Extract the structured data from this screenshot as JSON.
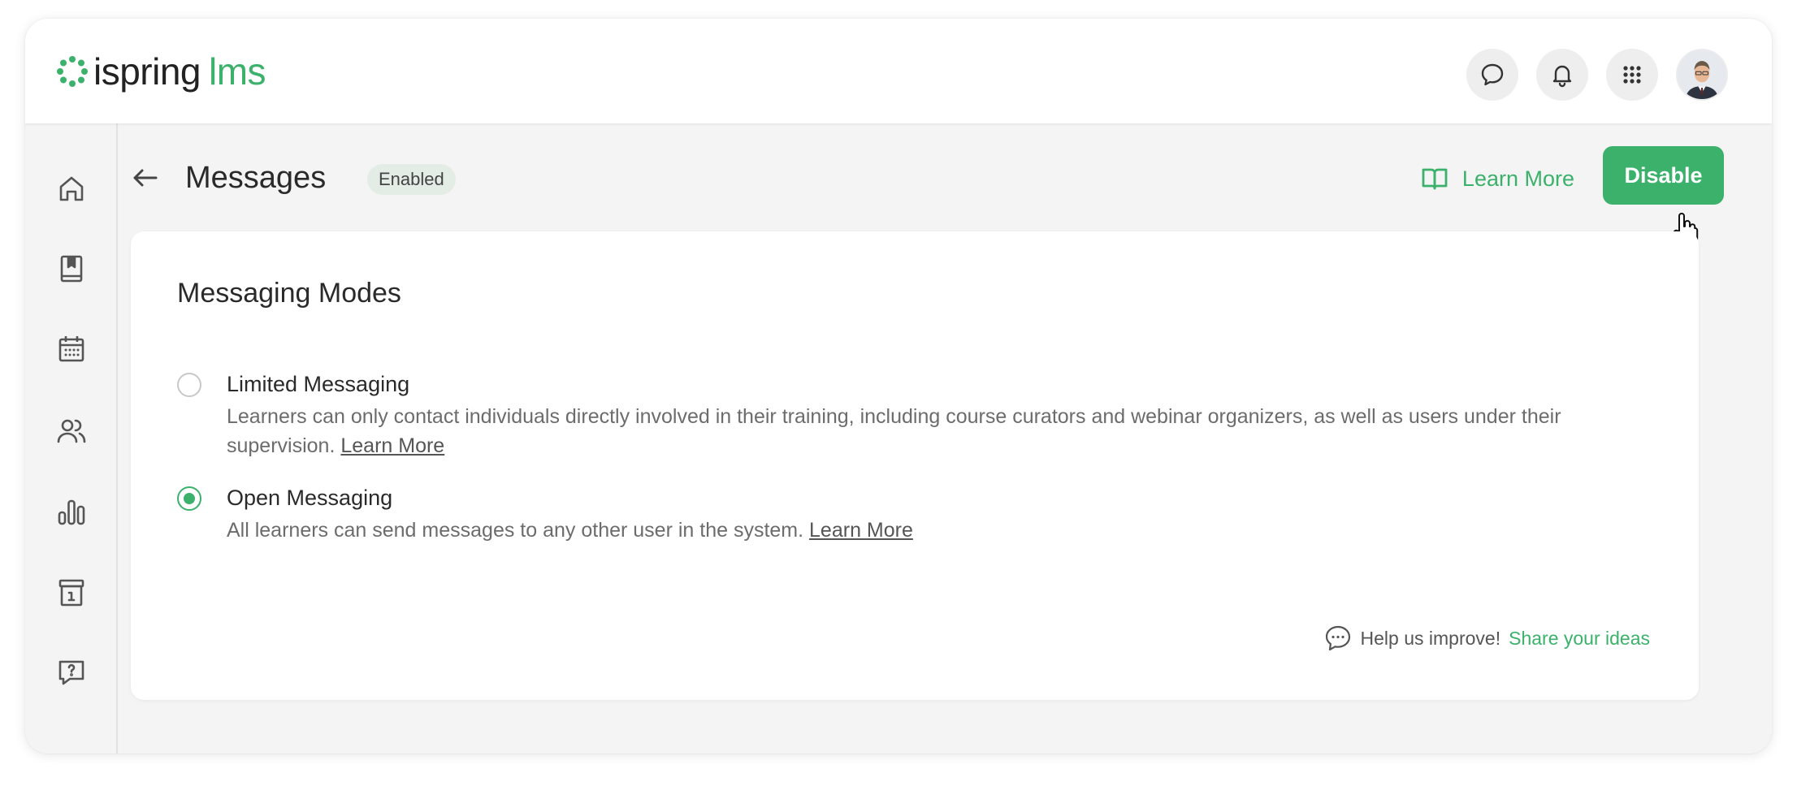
{
  "brand": {
    "name": "ispring",
    "suffix": "lms",
    "accent_color": "#3bb16b"
  },
  "topbar": {
    "icons": [
      "chat-icon",
      "bell-icon",
      "apps-grid-icon",
      "user-avatar"
    ]
  },
  "sidebar": {
    "items": [
      {
        "icon": "home-icon"
      },
      {
        "icon": "book-icon"
      },
      {
        "icon": "calendar-icon"
      },
      {
        "icon": "users-icon"
      },
      {
        "icon": "chart-icon"
      },
      {
        "icon": "info-box-icon"
      },
      {
        "icon": "help-chat-icon"
      }
    ]
  },
  "page": {
    "title": "Messages",
    "status": "Enabled",
    "learn_more": "Learn More",
    "disable_label": "Disable"
  },
  "card": {
    "title": "Messaging Modes",
    "options": [
      {
        "label": "Limited Messaging",
        "description": "Learners can only contact individuals directly involved in their training, including course curators and webinar organizers, as well as users under their supervision.",
        "link": "Learn More",
        "selected": false
      },
      {
        "label": "Open Messaging",
        "description": "All learners can send messages to any other user in the system.",
        "link": "Learn More",
        "selected": true
      }
    ],
    "feedback": {
      "prompt": "Help us improve!",
      "link": "Share your ideas"
    }
  }
}
